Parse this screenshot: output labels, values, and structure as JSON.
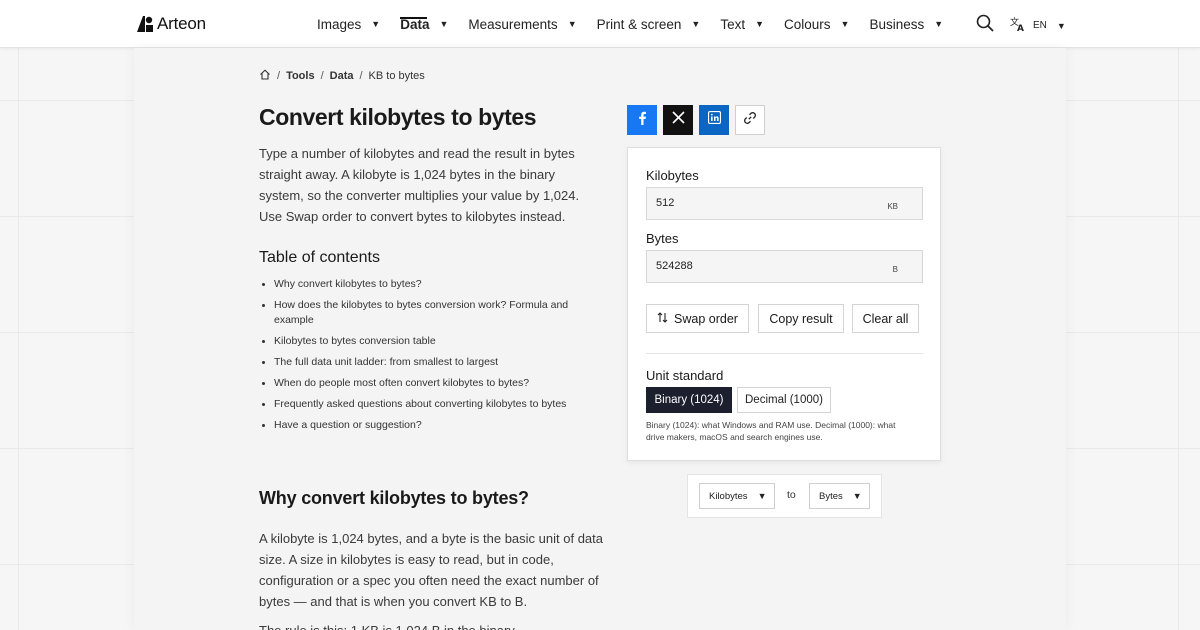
{
  "brand": {
    "name": "Arteon"
  },
  "nav": {
    "items": [
      {
        "label": "Images"
      },
      {
        "label": "Data"
      },
      {
        "label": "Measurements"
      },
      {
        "label": "Print & screen"
      },
      {
        "label": "Text"
      },
      {
        "label": "Colours"
      },
      {
        "label": "Business"
      }
    ],
    "active": "Data",
    "language": "EN"
  },
  "breadcrumb": {
    "items": [
      "Tools",
      "Data",
      "KB to bytes"
    ]
  },
  "page": {
    "title": "Convert kilobytes to bytes",
    "intro": "Type a number of kilobytes and read the result in bytes straight away. A kilobyte is 1,024 bytes in the binary system, so the converter multiplies your value by 1,024. Use Swap order to convert bytes to kilobytes instead."
  },
  "toc": {
    "title": "Table of contents",
    "items": [
      "Why convert kilobytes to bytes?",
      "How does the kilobytes to bytes conversion work? Formula and example",
      "Kilobytes to bytes conversion table",
      "The full data unit ladder: from smallest to largest",
      "When do people most often convert kilobytes to bytes?",
      "Frequently asked questions about converting kilobytes to bytes",
      "Have a question or suggestion?"
    ]
  },
  "section1": {
    "title": "Why convert kilobytes to bytes?",
    "body": "A kilobyte is 1,024 bytes, and a byte is the basic unit of data size. A size in kilobytes is easy to read, but in code, configuration or a spec you often need the exact number of bytes — and that is when you convert KB to B.",
    "next": "The rule is this: 1 KB is 1,024 B in the binary"
  },
  "converter": {
    "input": {
      "label": "Kilobytes",
      "value": "512",
      "unit": "KB"
    },
    "output": {
      "label": "Bytes",
      "value": "524288",
      "unit": "B"
    },
    "actions": {
      "swap": "Swap order",
      "copy": "Copy result",
      "clear": "Clear all"
    },
    "standard": {
      "label": "Unit standard",
      "binary": "Binary (1024)",
      "decimal": "Decimal (1000)",
      "selected": "binary",
      "note": "Binary (1024): what Windows and RAM use. Decimal (1000): what drive makers, macOS and search engines use."
    }
  },
  "unit_selector": {
    "from": "Kilobytes",
    "connector": "to",
    "to": "Bytes"
  },
  "colors": {
    "facebook": "#1877f2",
    "x": "#111111",
    "linkedin": "#0a66c2",
    "selected_segment": "#1b1f2e"
  },
  "icons": [
    "logo-icon",
    "home-icon",
    "search-icon",
    "translate-icon",
    "facebook-icon",
    "x-icon",
    "linkedin-icon",
    "link-icon",
    "swap-icon",
    "chevron-down-icon"
  ]
}
